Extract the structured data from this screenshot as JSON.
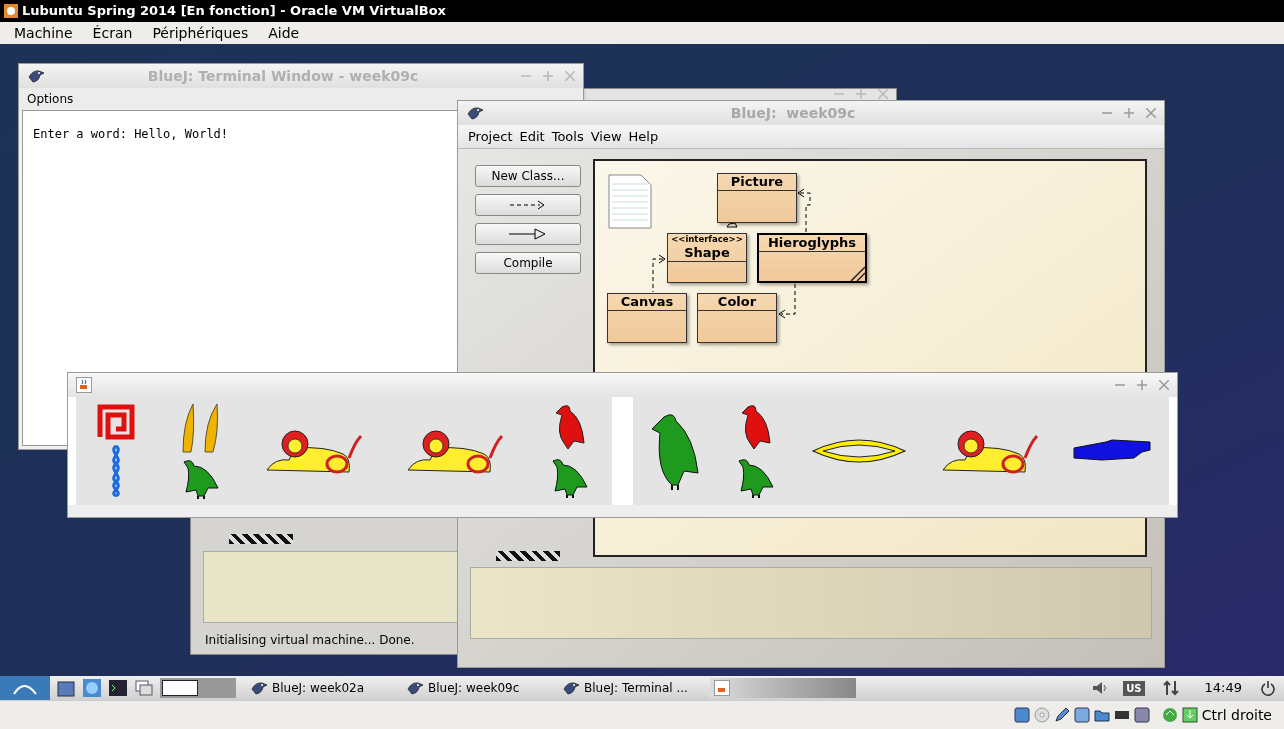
{
  "vm_window": {
    "title": "Lubuntu Spring 2014 [En fonction] - Oracle VM VirtualBox",
    "menu": [
      "Machine",
      "Écran",
      "Périphériques",
      "Aide"
    ]
  },
  "back_window": {
    "status": "Initialising virtual machine... Done."
  },
  "terminal_window": {
    "title": "BlueJ: Terminal Window - week09c",
    "menu": [
      "Options"
    ],
    "output": "Enter a word: Hello, World!"
  },
  "project_window": {
    "title": "BlueJ:  week09c",
    "menu": [
      "Project",
      "Edit",
      "Tools",
      "View",
      "Help"
    ],
    "buttons": [
      {
        "kind": "text",
        "label": "New Class..."
      },
      {
        "kind": "uses-arrow"
      },
      {
        "kind": "inherits-arrow"
      },
      {
        "kind": "text",
        "label": "Compile"
      }
    ],
    "classes": [
      {
        "name": "Picture",
        "selected": false,
        "uncompiled": false
      },
      {
        "stereotype": "<<interface>>",
        "name": "Shape",
        "selected": false,
        "uncompiled": false
      },
      {
        "name": "Hieroglyphs",
        "selected": true,
        "uncompiled": true
      },
      {
        "name": "Canvas",
        "selected": false,
        "uncompiled": false
      },
      {
        "name": "Color",
        "selected": false,
        "uncompiled": false
      }
    ]
  },
  "glyph_window": {
    "panels": [
      {
        "columns": [
          [
            {
              "kind": "spiral"
            },
            {
              "kind": "rope"
            }
          ],
          [
            {
              "kind": "reeds"
            },
            {
              "kind": "vulture"
            }
          ],
          [
            {
              "kind": "lion"
            }
          ],
          [
            {
              "kind": "lion"
            }
          ],
          [
            {
              "kind": "small-bird"
            },
            {
              "kind": "vulture"
            }
          ]
        ]
      },
      {
        "columns": [
          [
            {
              "kind": "large-bird"
            }
          ],
          [
            {
              "kind": "small-bird"
            },
            {
              "kind": "vulture"
            }
          ],
          [
            {
              "kind": "mouth"
            }
          ],
          [
            {
              "kind": "lion"
            }
          ],
          [
            {
              "kind": "hand"
            }
          ]
        ]
      }
    ]
  },
  "taskbar": {
    "tasks": [
      {
        "label": "BlueJ: week02a"
      },
      {
        "label": "BlueJ: week09c"
      },
      {
        "label": "BlueJ: Terminal ..."
      }
    ],
    "keyboard": "US",
    "clock": "14:49"
  },
  "vm_status": {
    "host_key": "Ctrl droite"
  }
}
